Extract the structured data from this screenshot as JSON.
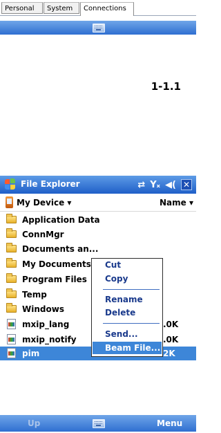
{
  "settings_tabs": [
    "Personal",
    "System",
    "Connections"
  ],
  "active_settings_tab": "Connections",
  "figure_label": "1-1.1",
  "window": {
    "title": "File Explorer",
    "status_icons": [
      "sync-icon",
      "signal-off-icon",
      "volume-icon"
    ],
    "close_label": "✕"
  },
  "pathbar": {
    "location": "My Device ▾",
    "sort": "Name ▾"
  },
  "files": [
    {
      "name": "Application Data",
      "type": "folder",
      "size": ""
    },
    {
      "name": "ConnMgr",
      "type": "folder",
      "size": ""
    },
    {
      "name": "Documents an...",
      "type": "folder",
      "size": ""
    },
    {
      "name": "My Documents",
      "type": "folder",
      "size": ""
    },
    {
      "name": "Program Files",
      "type": "folder",
      "size": ""
    },
    {
      "name": "Temp",
      "type": "folder",
      "size": ""
    },
    {
      "name": "Windows",
      "type": "folder",
      "size": ""
    },
    {
      "name": "mxip_lang",
      "type": "file",
      "size": ".0K"
    },
    {
      "name": "mxip_notify",
      "type": "file",
      "size": ".0K"
    },
    {
      "name": "pim",
      "type": "file",
      "size": "2K",
      "selected": true
    }
  ],
  "context_menu": {
    "items": [
      "Cut",
      "Copy",
      "Rename",
      "Delete",
      "Send...",
      "Beam File..."
    ],
    "highlighted": "Beam File..."
  },
  "softkeys": {
    "left": "Up",
    "right": "Menu"
  },
  "colors": {
    "bar_blue": "#2f6fd1",
    "selection": "#3d86d8",
    "menu_text": "#1a3a8c"
  }
}
